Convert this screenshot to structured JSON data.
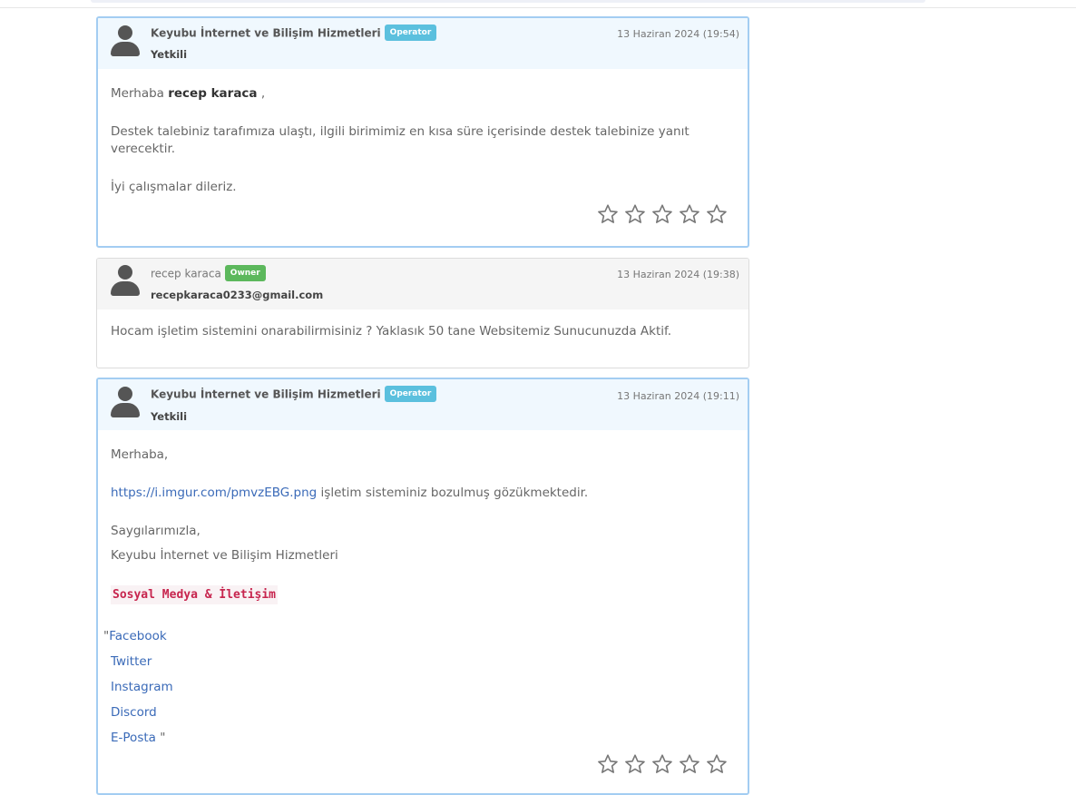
{
  "messages": [
    {
      "author": "Keyubu İnternet ve Bilişim Hizmetleri",
      "badge": "Operator",
      "subtitle": "Yetkili",
      "date": "13 Haziran 2024 (19:54)",
      "greeting": "Merhaba",
      "greeting_name": "recep karaca",
      "greeting_suffix": " ,",
      "line1": "Destek talebiniz tarafımıza ulaştı, ilgili birimimiz en kısa süre içerisinde destek talebinize yanıt verecektir.",
      "line2": "İyi çalışmalar dileriz."
    },
    {
      "author": "recep karaca",
      "badge": "Owner",
      "subtitle": "recepkaraca0233@gmail.com",
      "date": "13 Haziran 2024 (19:38)",
      "text": "Hocam işletim sistemini onarabilirmisiniz ? Yaklasık 50 tane Websitemiz Sunucunuzda Aktif."
    },
    {
      "author": "Keyubu İnternet ve Bilişim Hizmetleri",
      "badge": "Operator",
      "subtitle": "Yetkili",
      "date": "13 Haziran 2024 (19:11)",
      "greeting": "Merhaba,",
      "link": "https://i.imgur.com/pmvzEBG.png",
      "link_suffix": " işletim sisteminiz bozulmuş gözükmektedir.",
      "regards": "Saygılarımızla,",
      "company": "Keyubu İnternet ve Bilişim Hizmetleri",
      "social_title": "Sosyal Medya & İletişim",
      "social": [
        {
          "prefix": "\"",
          "label": "Facebook",
          "suffix": ""
        },
        {
          "prefix": "",
          "label": "Twitter",
          "suffix": ""
        },
        {
          "prefix": "",
          "label": "Instagram",
          "suffix": ""
        },
        {
          "prefix": "",
          "label": "Discord",
          "suffix": ""
        },
        {
          "prefix": "",
          "label": "E-Posta",
          "suffix": " \""
        }
      ]
    }
  ],
  "rating": {
    "max": 5,
    "value": 0
  },
  "colors": {
    "staff_border": "#a3cdf2",
    "operator_badge": "#5bc0de",
    "owner_badge": "#5cb85c",
    "link": "#3a6ab8"
  }
}
